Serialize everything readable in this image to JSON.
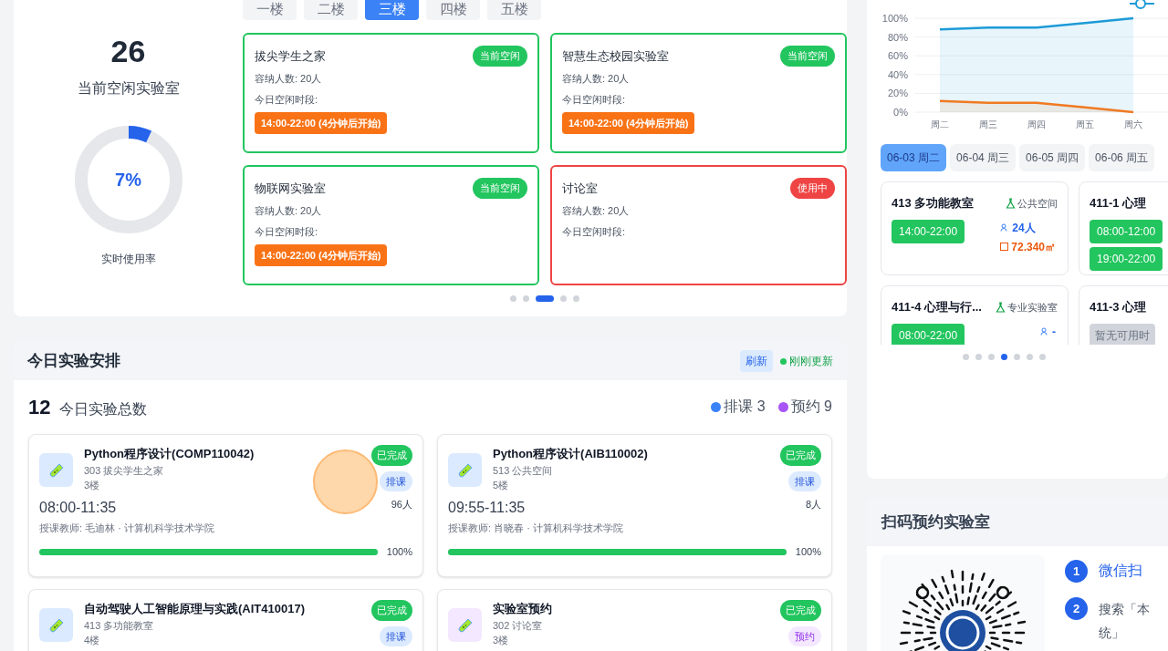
{
  "floor_tabs": [
    {
      "label": "一楼",
      "selected": false
    },
    {
      "label": "二楼",
      "selected": false
    },
    {
      "label": "三楼",
      "selected": true
    },
    {
      "label": "四楼",
      "selected": false
    },
    {
      "label": "五楼",
      "selected": false
    }
  ],
  "idle_stats": {
    "count": "26",
    "label": "当前空闲实验室",
    "usage": {
      "level": 0.07,
      "reading": "7%",
      "label": "实时使用率"
    }
  },
  "rooms": [
    {
      "name": "拔尖学生之家",
      "kind": "free",
      "status": "当前空闲",
      "capacity": "容纳人数: 20人",
      "slot_label": "今日空闲时段:",
      "slot": "14:00-22:00 (4分钟后开始)"
    },
    {
      "name": "智慧生态校园实验室",
      "kind": "free",
      "status": "当前空闲",
      "capacity": "容纳人数: 20人",
      "slot_label": "今日空闲时段:",
      "slot": "14:00-22:00 (4分钟后开始)"
    },
    {
      "name": "物联网实验室",
      "kind": "free",
      "status": "当前空闲",
      "capacity": "容纳人数: 20人",
      "slot_label": "今日空闲时段:",
      "slot": "14:00-22:00 (4分钟后开始)"
    },
    {
      "name": "讨论室",
      "kind": "busy",
      "status": "使用中",
      "capacity": "容纳人数: 20人",
      "slot_label": "今日空闲时段:"
    }
  ],
  "room_pages": [
    {
      "selected": false
    },
    {
      "selected": false
    },
    {
      "selected": true
    },
    {
      "selected": false
    },
    {
      "selected": false
    }
  ],
  "schedule": {
    "title": "今日实验安排",
    "refresh": "刷新",
    "update_status": "刚刚更新",
    "total": "12",
    "total_label": "今日实验总数",
    "legend": [
      {
        "label": "排课 3",
        "color": "#3b82f6"
      },
      {
        "label": "预约 9",
        "color": "#a855f7"
      }
    ],
    "items": [
      {
        "title": "Python程序设计(COMP110042)",
        "room": "303 拔尖学生之家",
        "floor": "3楼",
        "status": "已完成",
        "kind": "course",
        "tag": "排课",
        "time": "08:00-11:35",
        "people": "96人",
        "teacher": "授课教师: 毛迪林 · 计算机科学技术学院",
        "level": 1,
        "reading": "100%"
      },
      {
        "title": "Python程序设计(AIB110002)",
        "room": "513 公共空间",
        "floor": "5楼",
        "status": "已完成",
        "kind": "course",
        "tag": "排课",
        "time": "09:55-11:35",
        "people": "8人",
        "teacher": "授课教师: 肖晓春 · 计算机科学技术学院",
        "level": 1,
        "reading": "100%"
      },
      {
        "title": "自动驾驶人工智能原理与实践(AIT410017)",
        "room": "413 多功能教室",
        "floor": "4楼",
        "status": "已完成",
        "kind": "course",
        "tag": "排课"
      },
      {
        "title": "实验室预约",
        "room": "302 讨论室",
        "floor": "3楼",
        "status": "已完成",
        "kind": "booking",
        "tag": "预约"
      }
    ]
  },
  "usage_chart": {
    "chart_data": {
      "type": "area",
      "grid": true,
      "categories": [
        "周二",
        "周三",
        "周四",
        "周五",
        "周六"
      ],
      "ylim": [
        0,
        100
      ],
      "yticks": [
        {
          "value": 0,
          "label": "0%"
        },
        {
          "value": 20,
          "label": "20%"
        },
        {
          "value": 40,
          "label": "40%"
        },
        {
          "value": 60,
          "label": "60%"
        },
        {
          "value": 80,
          "label": "80%"
        },
        {
          "value": 100,
          "label": "100%"
        }
      ],
      "series": [
        {
          "color": "#1e9bd7",
          "values": [
            88,
            90,
            90,
            95,
            100
          ]
        },
        {
          "color": "#f07a22",
          "values": [
            12,
            10,
            10,
            5,
            0
          ]
        }
      ]
    }
  },
  "date_tabs": [
    {
      "label": "06-03 周二",
      "selected": true
    },
    {
      "label": "06-04 周三",
      "selected": false
    },
    {
      "label": "06-05 周四",
      "selected": false
    },
    {
      "label": "06-06 周五",
      "selected": false
    }
  ],
  "day_rooms": [
    {
      "name": "413 多功能教室",
      "category": "公共空间",
      "slots": [
        "14:00-22:00"
      ],
      "people": "24人",
      "area": "72.340㎡"
    },
    {
      "name": "411-1 心理",
      "slots": [
        "08:00-12:00",
        "19:00-22:00"
      ]
    },
    {
      "name": "411-4 心理与行...",
      "category": "专业实验室",
      "slots": [
        "08:00-22:00"
      ],
      "people": "-"
    },
    {
      "name": "411-3 心理",
      "empty": "暂无可用时"
    }
  ],
  "day_pages": [
    {
      "selected": false
    },
    {
      "selected": false
    },
    {
      "selected": false
    },
    {
      "selected": true
    },
    {
      "selected": false
    },
    {
      "selected": false
    },
    {
      "selected": false
    }
  ],
  "qr_booking": {
    "title": "扫码预约实验室",
    "steps": [
      {
        "number": "1",
        "lines": [
          "微信扫"
        ]
      },
      {
        "number": "2",
        "lines": [
          "搜索「本",
          "统」"
        ]
      }
    ]
  }
}
